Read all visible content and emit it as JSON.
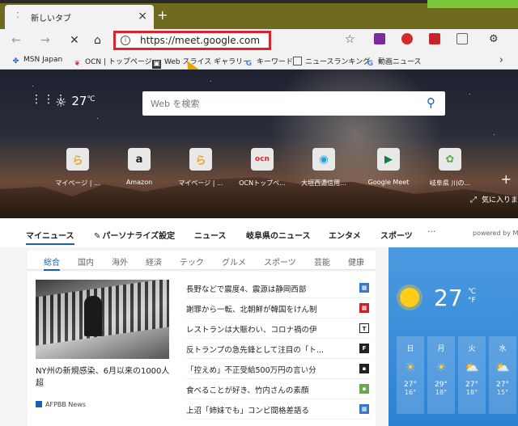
{
  "browser": {
    "tab_title": "新しいタブ",
    "tab_close": "×",
    "new_tab": "+",
    "url": "https://meet.google.com"
  },
  "bookmarks": [
    {
      "label": "MSN Japan",
      "icon": "msn-butterfly-icon"
    },
    {
      "label": "OCN | トップページ",
      "icon": "ocn-icon"
    },
    {
      "label": "Web スライス ギャラリー",
      "icon": "web-slice-icon"
    },
    {
      "label": "キーワード",
      "icon": "google-g-icon"
    },
    {
      "label": "ニュースランキング",
      "icon": "page-icon"
    },
    {
      "label": "動画ニュース",
      "icon": "google-g-icon"
    }
  ],
  "hero": {
    "temperature": "27",
    "unit": "℃",
    "search_placeholder": "Web を検索",
    "tiles": [
      {
        "label": "マイページ | ...",
        "glyph": "ら",
        "color": "#f0a020"
      },
      {
        "label": "Amazon",
        "glyph": "a",
        "color": "#222222"
      },
      {
        "label": "マイページ | ...",
        "glyph": "ら",
        "color": "#f0a020"
      },
      {
        "label": "OCNトップペ...",
        "glyph": "ocn",
        "color": "#d42a2a"
      },
      {
        "label": "大垣西濃信用...",
        "glyph": "◉",
        "color": "#1aa0e0"
      },
      {
        "label": "Google Meet",
        "glyph": "▶",
        "color": "#0b8043"
      },
      {
        "label": "岐阜県 川の...",
        "glyph": "✿",
        "color": "#6aa84f"
      }
    ],
    "caption": "気に入りま"
  },
  "news_nav": {
    "items": [
      "マイニュース",
      "パーソナライズ設定",
      "ニュース",
      "岐阜県のニュース",
      "エンタメ",
      "スポーツ"
    ],
    "more": "···",
    "powered_by": "powered by M"
  },
  "categories": [
    "総合",
    "国内",
    "海外",
    "経済",
    "テック",
    "グルメ",
    "スポーツ",
    "芸能",
    "健康"
  ],
  "main_story": {
    "headline": "NY州の新規感染、6月以来の1000人超",
    "source": "AFPBB News"
  },
  "headlines": [
    {
      "text": "長野などで震度4、震源は静岡西部",
      "badge_color": "#3a78c2"
    },
    {
      "text": "謝罪から一転、北朝鮮が韓国をけん制",
      "badge_color": "#c8232b"
    },
    {
      "text": "レストランは大賑わい、コロナ禍の伊",
      "badge_color": "#222222"
    },
    {
      "text": "反トランプの急先鋒として注目の「ト...",
      "badge_color": "#222222"
    },
    {
      "text": "「控えめ」不正受給500万円の言い分",
      "badge_color": "#222222"
    },
    {
      "text": "食べることが好き、竹内さんの素顔",
      "badge_color": "#6aa84f"
    },
    {
      "text": "上沼「姉妹でも」コンビ間格差語る",
      "badge_color": "#3a78c2"
    }
  ],
  "weather": {
    "temperature": "27",
    "unit_c": "℃",
    "unit_f": "°F",
    "days": [
      {
        "name": "日",
        "hi": "27°",
        "lo": "16°",
        "icon": "☀"
      },
      {
        "name": "月",
        "hi": "29°",
        "lo": "18°",
        "icon": "☀"
      },
      {
        "name": "火",
        "hi": "27°",
        "lo": "18°",
        "icon": "⛅"
      },
      {
        "name": "水",
        "hi": "27°",
        "lo": "15°",
        "icon": "⛅"
      }
    ]
  }
}
